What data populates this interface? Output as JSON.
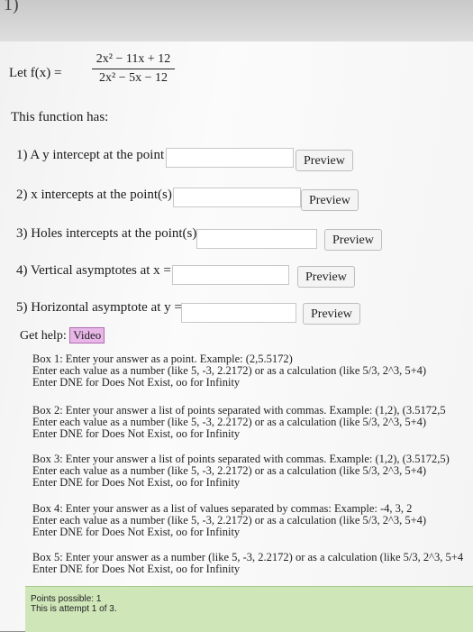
{
  "header": {
    "corner_mark": "1)"
  },
  "function_def": {
    "lead": "Let f(x) =",
    "numerator": "2x² − 11x + 12",
    "denominator": "2x² − 5x − 12"
  },
  "intro": "This function has:",
  "questions": [
    {
      "label": "1) A y intercept at the point",
      "value": "",
      "preview": "Preview"
    },
    {
      "label": "2) x intercepts at the point(s)",
      "value": "",
      "preview": "Preview"
    },
    {
      "label": "3) Holes intercepts at the point(s)",
      "value": "",
      "preview": "Preview"
    },
    {
      "label": "4) Vertical asymptotes at x =",
      "value": "",
      "preview": "Preview"
    },
    {
      "label": "5) Horizontal asymptote at y =",
      "value": "",
      "preview": "Preview"
    }
  ],
  "help": {
    "label": "Get help:",
    "video": "Video"
  },
  "boxes": [
    {
      "lines": [
        "Box 1: Enter your answer as a point. Example: (2,5.5172)",
        "Enter each value as a number (like 5, -3, 2.2172) or as a calculation (like 5/3, 2^3, 5+4)",
        "Enter DNE for Does Not Exist, oo for Infinity"
      ]
    },
    {
      "lines": [
        "Box 2: Enter your answer a list of points separated with commas. Example: (1,2), (3.5172,5",
        "Enter each value as a number (like 5, -3, 2.2172) or as a calculation (like 5/3, 2^3, 5+4)",
        "Enter DNE for Does Not Exist, oo for Infinity"
      ]
    },
    {
      "lines": [
        "Box 3: Enter your answer a list of points separated with commas. Example: (1,2), (3.5172,5)",
        "Enter each value as a number (like 5, -3, 2.2172) or as a calculation (like 5/3, 2^3, 5+4)",
        "Enter DNE for Does Not Exist, oo for Infinity"
      ]
    },
    {
      "lines": [
        "Box 4: Enter your answer as a list of values separated by commas: Example: -4, 3, 2",
        "Enter each value as a number (like 5, -3, 2.2172) or as a calculation (like 5/3, 2^3, 5+4)",
        "Enter DNE for Does Not Exist, oo for Infinity"
      ]
    },
    {
      "lines": [
        "Box 5: Enter your answer as a number (like 5, -3, 2.2172) or as a calculation (like 5/3, 2^3, 5+4",
        "Enter DNE for Does Not Exist, oo for Infinity"
      ]
    }
  ],
  "footer": {
    "points_possible": "Points possible: 1",
    "attempt": "This is attempt 1 of 3."
  }
}
